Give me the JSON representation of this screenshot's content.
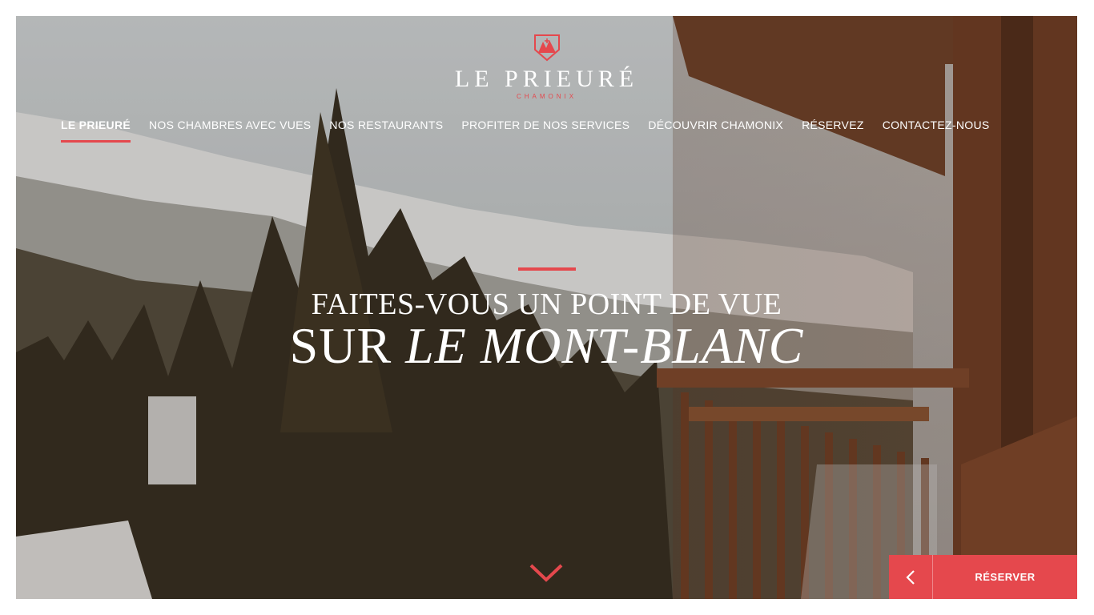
{
  "brand": {
    "name": "LE PRIEURÉ",
    "location": "CHAMONIX",
    "accent_color": "#e5484d",
    "logo_icon": "mountain-shield-icon"
  },
  "nav": {
    "items": [
      {
        "label": "LE PRIEURÉ",
        "active": true
      },
      {
        "label": "NOS CHAMBRES AVEC VUES",
        "active": false
      },
      {
        "label": "NOS RESTAURANTS",
        "active": false
      },
      {
        "label": "PROFITER DE NOS SERVICES",
        "active": false
      },
      {
        "label": "DÉCOUVRIR CHAMONIX",
        "active": false
      },
      {
        "label": "RÉSERVEZ",
        "active": false
      },
      {
        "label": "CONTACTEZ-NOUS",
        "active": false
      }
    ]
  },
  "hero": {
    "line1": "FAITES-VOUS UN POINT DE VUE",
    "line2_plain": "SUR ",
    "line2_italic": "LE MONT-BLANC"
  },
  "scroll": {
    "icon": "chevron-down-icon"
  },
  "reserve": {
    "back_icon": "chevron-left-icon",
    "label": "RÉSERVER"
  }
}
